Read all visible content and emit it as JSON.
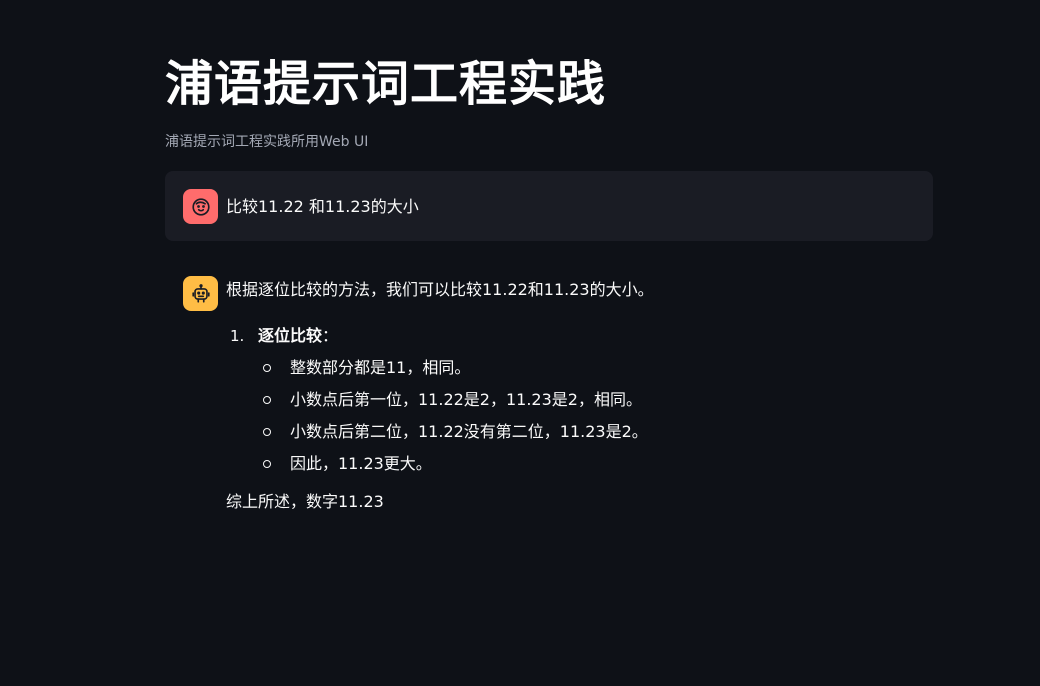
{
  "app": {
    "title": "浦语提示词工程实践",
    "subtitle": "浦语提示词工程实践所用Web UI"
  },
  "chat": {
    "user_message": {
      "avatar_icon": "user-face-icon",
      "avatar_color": "#ff6c6c",
      "text": "比较11.22 和11.23的大小"
    },
    "assistant_message": {
      "avatar_icon": "robot-icon",
      "avatar_color": "#ffbd45",
      "intro": "根据逐位比较的方法，我们可以比较11.22和11.23的大小。",
      "list": [
        {
          "number": "1.",
          "label": "逐位比较",
          "suffix": "：",
          "bullets": [
            "整数部分都是11，相同。",
            "小数点后第一位，11.22是2，11.23是2，相同。",
            "小数点后第二位，11.22没有第二位，11.23是2。",
            "因此，11.23更大。"
          ]
        }
      ],
      "conclusion": "综上所述，数字11.23"
    }
  },
  "colors": {
    "background": "#0e1117",
    "user_bubble": "#1a1c24",
    "text": "#fafafa",
    "muted": "#a3a8b4"
  }
}
